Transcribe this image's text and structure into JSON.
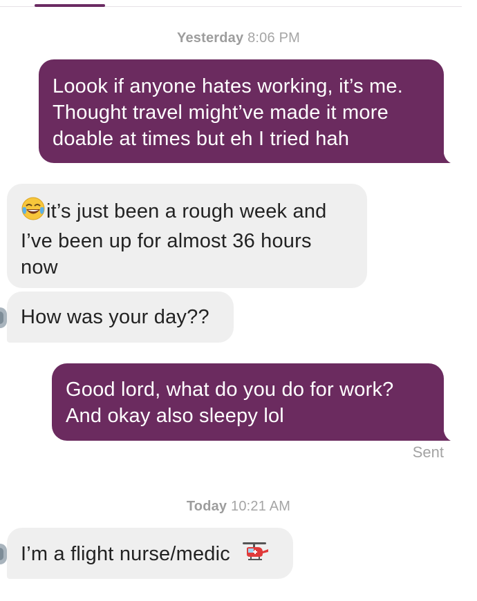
{
  "header": {
    "active_tab_color": "#6b2b63"
  },
  "colors": {
    "outgoing_bubble": "#6b2b5f",
    "incoming_bubble": "#efefef",
    "timestamp_text": "#9b9b9b"
  },
  "thread": {
    "separator_yesterday": {
      "day": "Yesterday",
      "time": "8:06 PM"
    },
    "separator_today": {
      "day": "Today",
      "time": "10:21 AM"
    },
    "messages": [
      {
        "direction": "outgoing",
        "lines": [
          "Loook if anyone hates working, it’s me.",
          "Thought travel might’ve made it more",
          "doable at times but eh I tried hah"
        ]
      },
      {
        "direction": "incoming",
        "emoji": "face-with-tears-of-joy",
        "lines": [
          "it’s just been a rough week and",
          "I’ve been up for almost 36 hours",
          "now"
        ]
      },
      {
        "direction": "incoming",
        "lines": [
          "How was your day??"
        ]
      },
      {
        "direction": "outgoing",
        "lines": [
          "Good lord, what do you do for work?",
          "And okay also sleepy lol"
        ],
        "status": "Sent"
      },
      {
        "direction": "incoming",
        "lines": [
          "I’m a flight nurse/medic"
        ],
        "emoji": "helicopter"
      }
    ]
  }
}
